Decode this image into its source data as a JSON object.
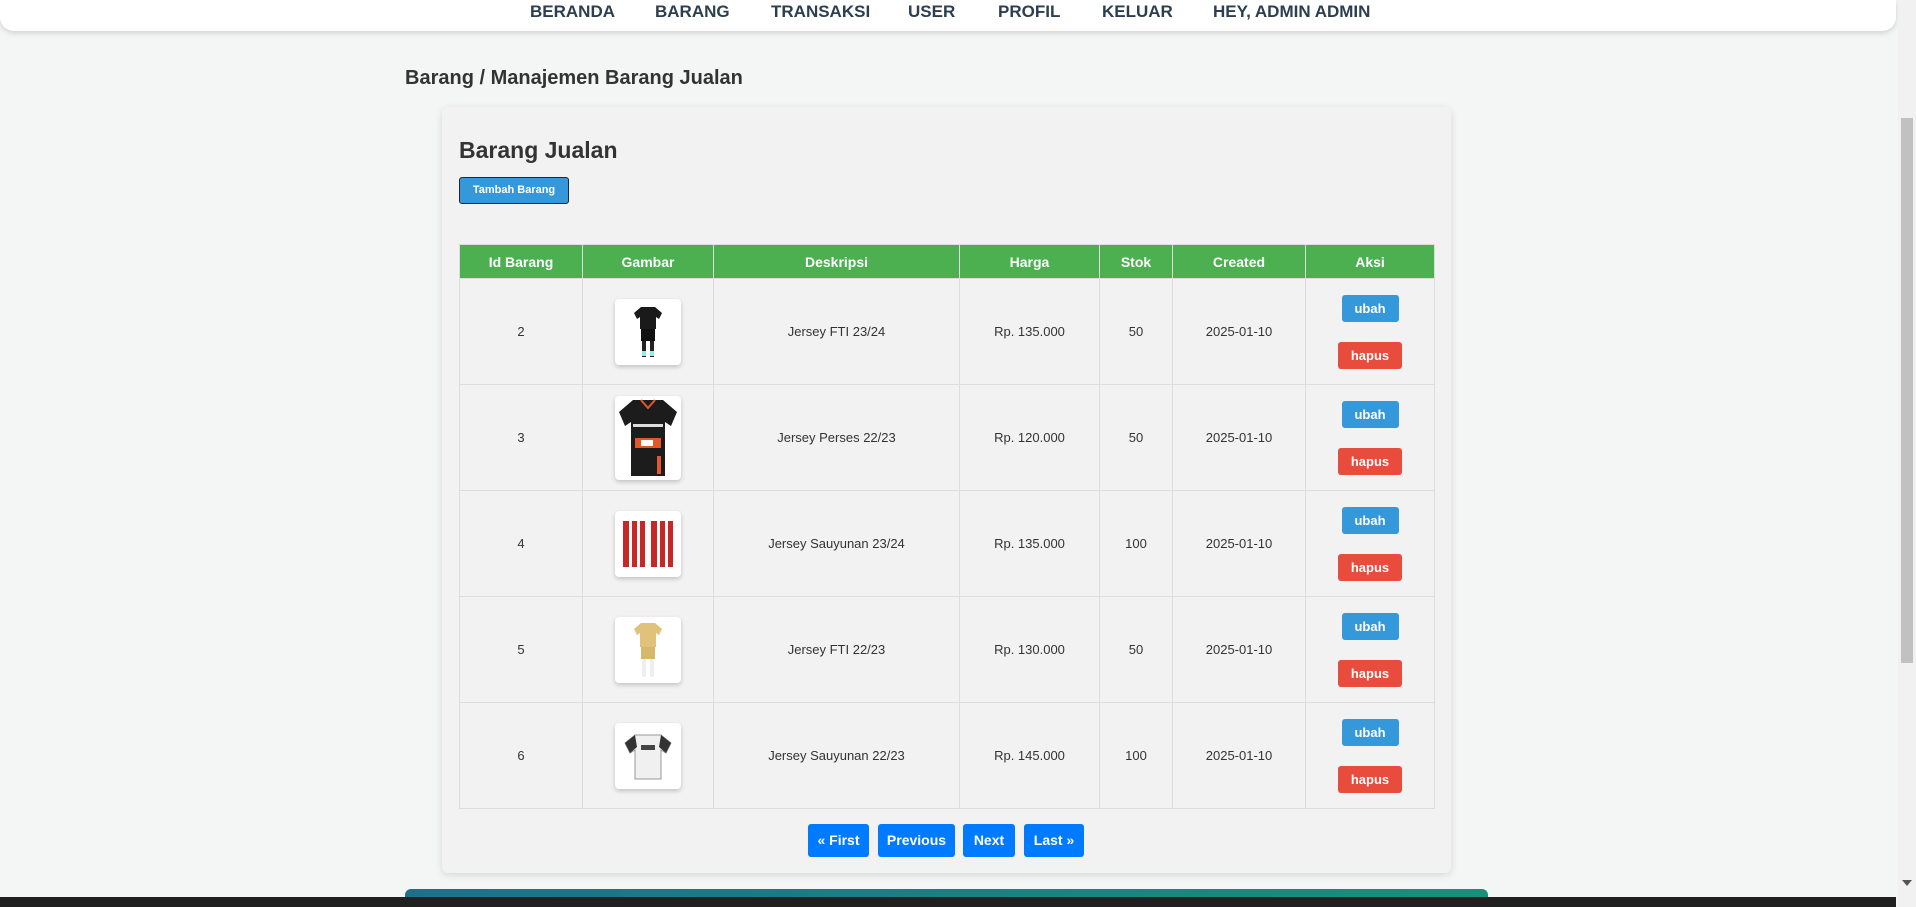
{
  "nav": {
    "items": [
      "BERANDA",
      "BARANG",
      "TRANSAKSI",
      "USER",
      "PROFIL",
      "KELUAR",
      "HEY, ADMIN ADMIN"
    ]
  },
  "breadcrumb": "Barang / Manajemen Barang Jualan",
  "card": {
    "title": "Barang Jualan",
    "add_button": "Tambah Barang"
  },
  "table": {
    "headers": [
      "Id Barang",
      "Gambar",
      "Deskripsi",
      "Harga",
      "Stok",
      "Created",
      "Aksi"
    ],
    "rows": [
      {
        "id": "2",
        "image": "jersey-fti-23-24",
        "desc": "Jersey FTI 23/24",
        "price": "Rp. 135.000",
        "stock": "50",
        "created": "2025-01-10"
      },
      {
        "id": "3",
        "image": "jersey-perses-22-23",
        "desc": "Jersey Perses 22/23",
        "price": "Rp. 120.000",
        "stock": "50",
        "created": "2025-01-10"
      },
      {
        "id": "4",
        "image": "jersey-sauyunan-23-24",
        "desc": "Jersey Sauyunan 23/24",
        "price": "Rp. 135.000",
        "stock": "100",
        "created": "2025-01-10"
      },
      {
        "id": "5",
        "image": "jersey-fti-22-23",
        "desc": "Jersey FTI 22/23",
        "price": "Rp. 130.000",
        "stock": "50",
        "created": "2025-01-10"
      },
      {
        "id": "6",
        "image": "jersey-sauyunan-22-23",
        "desc": "Jersey Sauyunan 22/23",
        "price": "Rp. 145.000",
        "stock": "100",
        "created": "2025-01-10"
      }
    ],
    "edit_label": "ubah",
    "delete_label": "hapus"
  },
  "pagination": {
    "first": "« First",
    "previous": "Previous",
    "next": "Next",
    "last": "Last »"
  },
  "colors": {
    "header_green": "#4caf50",
    "edit_blue": "#3498db",
    "delete_red": "#e74c3c",
    "pager_blue": "#007bff"
  }
}
